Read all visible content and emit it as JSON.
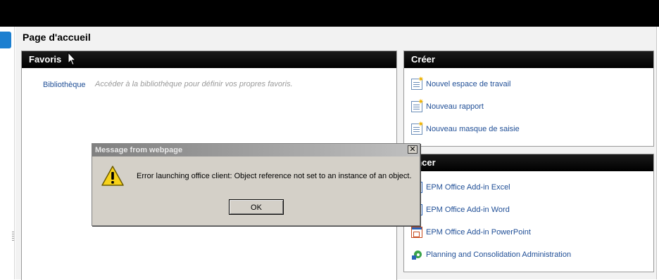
{
  "page": {
    "title": "Page d'accueil"
  },
  "favorites": {
    "header": "Favoris",
    "link": "Bibliothèque",
    "hint": "Accéder à la bibliothèque pour définir vos propres favoris."
  },
  "create": {
    "header": "Créer",
    "items": [
      {
        "label": "Nouvel espace de travail",
        "icon": "new-workspace-icon"
      },
      {
        "label": "Nouveau rapport",
        "icon": "new-report-icon"
      },
      {
        "label": "Nouveau masque de saisie",
        "icon": "new-input-form-icon"
      }
    ]
  },
  "launch": {
    "header": "ancer",
    "items": [
      {
        "label": "EPM Office Add-in Excel",
        "icon": "excel-icon"
      },
      {
        "label": "EPM Office Add-in Word",
        "icon": "word-icon"
      },
      {
        "label": "EPM Office Add-in PowerPoint",
        "icon": "powerpoint-icon"
      },
      {
        "label": "Planning and Consolidation Administration",
        "icon": "planning-icon"
      }
    ]
  },
  "dialog": {
    "title": "Message from webpage",
    "close": "✕",
    "message": "Error launching office client: Object reference not set to an instance of an object.",
    "ok_label": "OK",
    "icon": "warning-icon"
  },
  "colors": {
    "link": "#1f4e96",
    "header_bg": "#000000",
    "left_tab": "#1c7fd0"
  }
}
